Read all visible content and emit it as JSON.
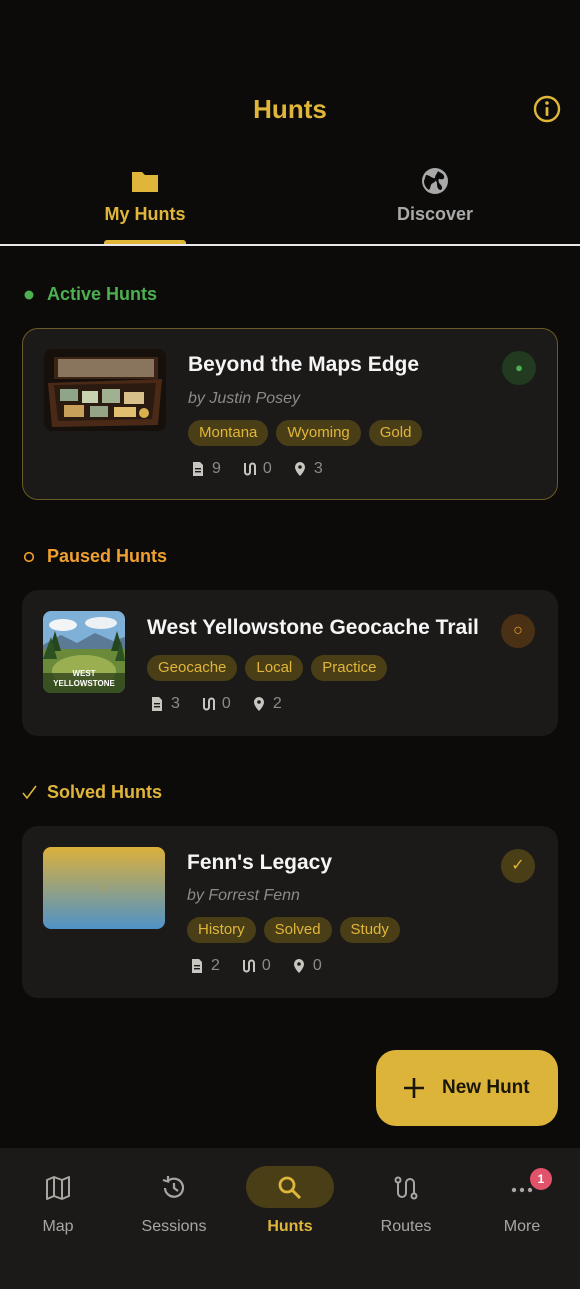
{
  "header": {
    "title": "Hunts"
  },
  "tabs": [
    {
      "label": "My Hunts",
      "active": true
    },
    {
      "label": "Discover",
      "active": false
    }
  ],
  "sections": {
    "active": {
      "label": "Active Hunts",
      "icon": "dot-icon",
      "color": "#4caf50"
    },
    "paused": {
      "label": "Paused Hunts",
      "icon": "circle-outline-icon",
      "color": "#f0a030"
    },
    "solved": {
      "label": "Solved Hunts",
      "icon": "check-icon",
      "color": "#e0b63a"
    }
  },
  "hunts": [
    {
      "title": "Beyond the Maps Edge",
      "author": "by Justin Posey",
      "tags": [
        "Montana",
        "Wyoming",
        "Gold"
      ],
      "stats": {
        "documents": "9",
        "routes": "0",
        "locations": "3"
      },
      "status_icon": "●"
    },
    {
      "title": "West Yellowstone Geocache Trail",
      "thumb_text": [
        "WEST",
        "YELLOWSTONE"
      ],
      "tags": [
        "Geocache",
        "Local",
        "Practice"
      ],
      "stats": {
        "documents": "3",
        "routes": "0",
        "locations": "2"
      },
      "status_icon": "○"
    },
    {
      "title": "Fenn's Legacy",
      "author": "by Forrest Fenn",
      "tags": [
        "History",
        "Solved",
        "Study"
      ],
      "stats": {
        "documents": "2",
        "routes": "0",
        "locations": "0"
      },
      "status_icon": "✓"
    }
  ],
  "fab": {
    "label": "New Hunt"
  },
  "bottom_nav": [
    {
      "label": "Map",
      "icon": "map-icon"
    },
    {
      "label": "Sessions",
      "icon": "history-icon"
    },
    {
      "label": "Hunts",
      "icon": "search-icon",
      "active": true
    },
    {
      "label": "Routes",
      "icon": "route-icon"
    },
    {
      "label": "More",
      "icon": "more-icon",
      "badge": "1"
    }
  ],
  "colors": {
    "accent": "#e0b63a",
    "background": "#0c0b0a",
    "card": "#1c1a18"
  }
}
